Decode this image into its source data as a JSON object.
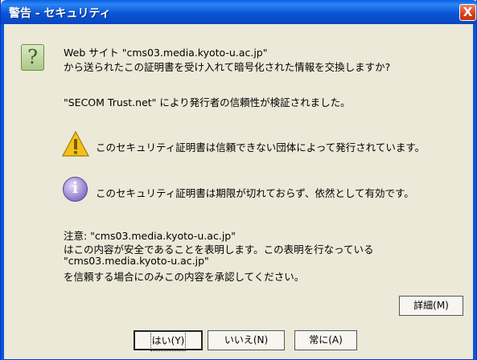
{
  "window": {
    "title": "警告 - セキュリティ",
    "close_label": "X"
  },
  "icons": {
    "question": "question-icon",
    "warning": "warning-icon",
    "info": "info-icon"
  },
  "message": {
    "line1": "Web サイト \"cms03.media.kyoto-u.ac.jp\"",
    "line2": "から送られたこの証明書を受け入れて暗号化された情報を交換しますか?",
    "verified": "\"SECOM Trust.net\" により発行者の信頼性が検証されました。",
    "warning": "このセキュリティ証明書は信頼できない団体によって発行されています。",
    "info": "このセキュリティ証明書は期限が切れておらず、依然として有効です。",
    "note1": "注意: \"cms03.media.kyoto-u.ac.jp\"",
    "note2": "はこの内容が安全であることを表明します。この表明を行なっている",
    "note3": "\"cms03.media.kyoto-u.ac.jp\"",
    "note4": "を信頼する場合にのみこの内容を承認してください。"
  },
  "buttons": {
    "details": "詳細(M)",
    "yes": "はい(Y)",
    "no": "いいえ(N)",
    "always": "常に(A)"
  }
}
